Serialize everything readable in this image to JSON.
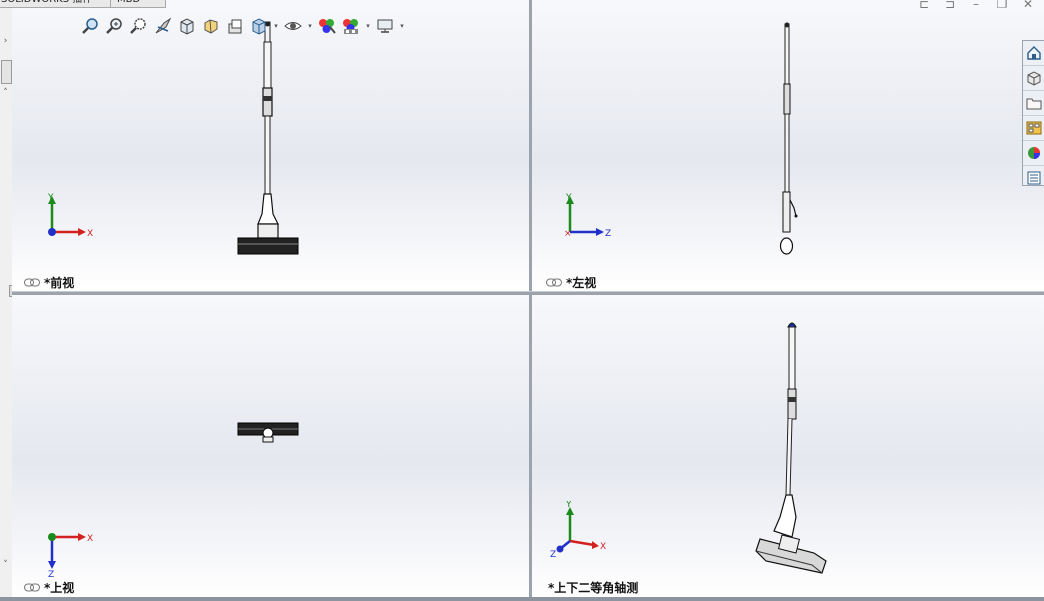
{
  "top_tabs": [
    {
      "label": "SOLIDWORKS 插件"
    },
    {
      "label": "MBD"
    }
  ],
  "heads_up_toolbar": {
    "icons": [
      "zoom-to-fit-icon",
      "zoom-to-area-icon",
      "previous-view-icon",
      "section-view-icon",
      "view-orientation-icon",
      "display-style-icon",
      "hide-show-items-icon",
      "edit-appearance-icon",
      "apply-scene-icon",
      "view-settings-icon"
    ]
  },
  "window_controls": [
    "tile-left-icon",
    "tile-right-icon",
    "minimize-icon",
    "restore-icon",
    "close-icon"
  ],
  "viewports": {
    "front": {
      "label": "*前视"
    },
    "left": {
      "label": "*左视"
    },
    "top": {
      "label": "*上视"
    },
    "iso": {
      "label": "*上下二等角轴测"
    }
  },
  "triads": {
    "front": {
      "x": "X",
      "y": "Y"
    },
    "left": {
      "z": "Z",
      "y": "Y"
    },
    "top": {
      "x": "X",
      "z": "Z"
    },
    "iso": {
      "x": "X",
      "y": "Y",
      "z": "Z"
    }
  },
  "task_pane": [
    "solidworks-resources-icon",
    "design-library-icon",
    "file-explorer-icon",
    "view-palette-icon",
    "appearances-scenes-icon",
    "custom-properties-icon"
  ],
  "colors": {
    "x_axis": "#d32020",
    "y_axis": "#1a8a1a",
    "z_axis": "#2030c8"
  }
}
